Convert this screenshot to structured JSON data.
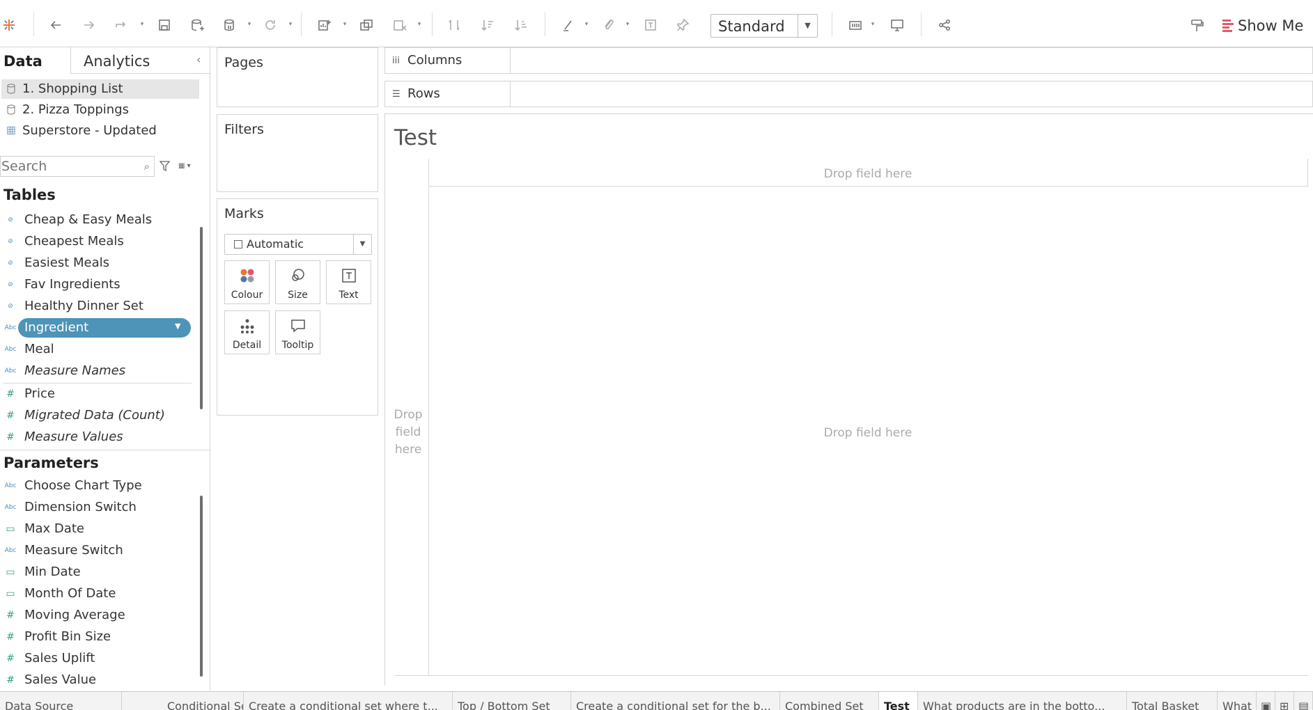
{
  "toolbar": {
    "fit_value": "Standard",
    "show_me_label": "Show Me"
  },
  "data_pane": {
    "tab_data": "Data",
    "tab_analytics": "Analytics",
    "data_sources": [
      {
        "label": "1. Shopping List",
        "active": true
      },
      {
        "label": "2. Pizza Toppings",
        "active": false
      },
      {
        "label": "Superstore - Updated",
        "active": false
      }
    ],
    "search_placeholder": "Search",
    "tables_title": "Tables",
    "tables": [
      {
        "label": "Cheap & Easy Meals",
        "type": "set"
      },
      {
        "label": "Cheapest Meals",
        "type": "set"
      },
      {
        "label": "Easiest Meals",
        "type": "set"
      },
      {
        "label": "Fav Ingredients",
        "type": "set"
      },
      {
        "label": "Healthy Dinner Set",
        "type": "set"
      },
      {
        "label": "Ingredient",
        "type": "abc",
        "selected": true
      },
      {
        "label": "Meal",
        "type": "abc"
      },
      {
        "label": "Measure Names",
        "type": "abc",
        "italic": true
      },
      {
        "label": "Price",
        "type": "measure"
      },
      {
        "label": "Migrated Data (Count)",
        "type": "measure",
        "italic": true
      },
      {
        "label": "Measure Values",
        "type": "measure",
        "italic": true
      }
    ],
    "parameters_title": "Parameters",
    "parameters": [
      {
        "label": "Choose Chart Type",
        "type": "abc"
      },
      {
        "label": "Dimension Switch",
        "type": "abc"
      },
      {
        "label": "Max Date",
        "type": "date"
      },
      {
        "label": "Measure Switch",
        "type": "abc"
      },
      {
        "label": "Min Date",
        "type": "date"
      },
      {
        "label": "Month Of Date",
        "type": "date"
      },
      {
        "label": "Moving Average",
        "type": "measure"
      },
      {
        "label": "Profit Bin Size",
        "type": "measure"
      },
      {
        "label": "Sales Uplift",
        "type": "measure"
      },
      {
        "label": "Sales Value",
        "type": "measure"
      }
    ]
  },
  "shelves": {
    "pages": "Pages",
    "filters": "Filters",
    "marks": "Marks",
    "marks_type": "Automatic",
    "mark_buttons": [
      "Colour",
      "Size",
      "Text",
      "Detail",
      "Tooltip"
    ],
    "columns": "Columns",
    "rows": "Rows"
  },
  "view": {
    "title": "Test",
    "drop_top": "Drop field here",
    "drop_center": "Drop field here",
    "drop_left_lines": [
      "Drop",
      "field",
      "here"
    ]
  },
  "sheet_tabs": [
    {
      "label": "Data Source",
      "active": false
    },
    {
      "label": "Conditional Set",
      "active": false
    },
    {
      "label": "Create a conditional set where t...",
      "active": false
    },
    {
      "label": "Top / Bottom Set",
      "active": false
    },
    {
      "label": "Create a conditional set for the b...",
      "active": false
    },
    {
      "label": "Combined Set",
      "active": false
    },
    {
      "label": "Test",
      "active": true
    },
    {
      "label": "What products are in the botto...",
      "active": false
    },
    {
      "label": "Total Basket",
      "active": false
    },
    {
      "label": "What",
      "active": false
    }
  ]
}
